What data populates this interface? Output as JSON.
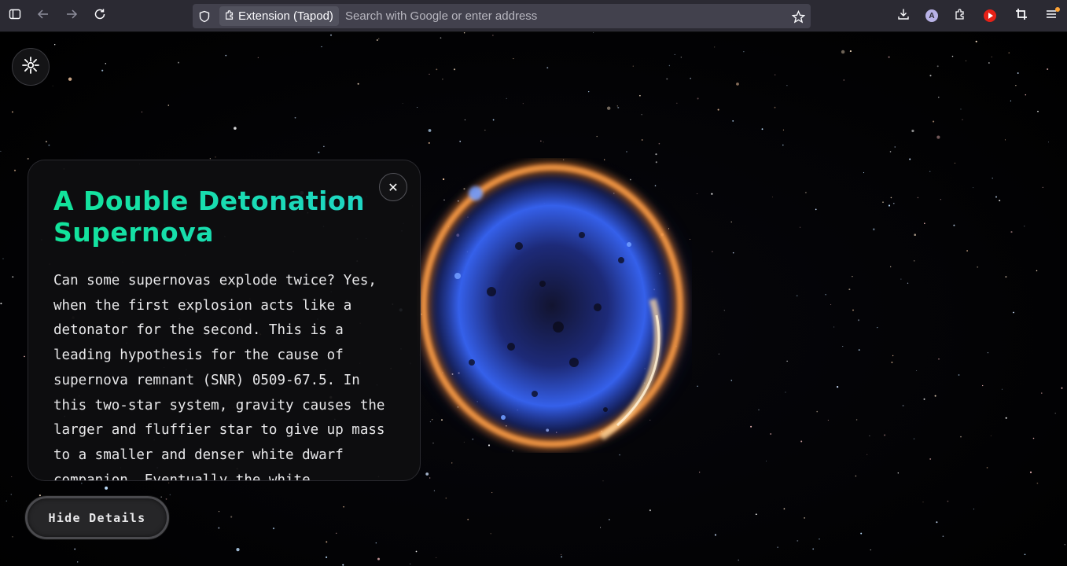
{
  "browser": {
    "identity_label": "Extension (Tapod)",
    "address_placeholder": "Search with Google or enter address",
    "account_initial": "A",
    "icons": {
      "sidebar": "sidebar-icon",
      "back": "back-arrow-icon",
      "forward": "forward-arrow-icon",
      "reload": "reload-icon",
      "tracking": "shield-icon",
      "extension": "puzzle-icon",
      "bookmark": "star-icon",
      "downloads": "download-icon",
      "extensions": "puzzle-icon",
      "youtube": "youtube-icon",
      "screenshot": "crop-icon",
      "menu": "hamburger-menu-icon"
    }
  },
  "page": {
    "settings_icon": "sparkle-icon",
    "card": {
      "title": "A Double Detonation Supernova",
      "close_symbol": "✕",
      "body": "Can some supernovas explode twice? Yes, when the first explosion acts like a detonator for the second. This is a leading hypothesis for the cause of supernova remnant (SNR) 0509-67.5. In this two-star system, gravity causes the larger and fluffier star to give up mass to a smaller and denser white dwarf companion. Eventually the white"
    },
    "hide_button_label": "Hide Details"
  },
  "colors": {
    "toolbar_bg": "#2b2a33",
    "urlbar_bg": "#42414d",
    "title_gradient_start": "#12e39a",
    "title_gradient_end": "#1fd6c4",
    "card_bg": "#0e0e10",
    "supernova_shell": "#ff8a2a",
    "supernova_core": "#3858e8"
  }
}
